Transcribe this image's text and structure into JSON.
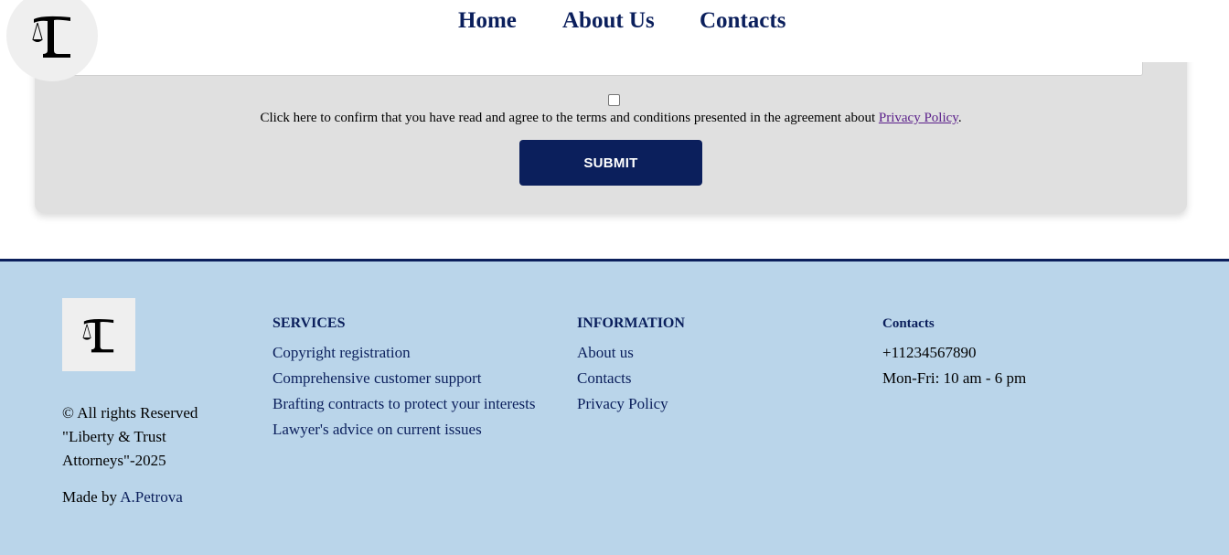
{
  "nav": {
    "home": "Home",
    "about": "About Us",
    "contacts": "Contacts"
  },
  "form": {
    "agree_text": "Click here to confirm that you have read and agree to the terms and conditions presented in the agreement about ",
    "privacy_link": "Privacy Policy",
    "agree_end": ".",
    "submit_label": "SUBMIT"
  },
  "footer": {
    "copyright_line1": "© All rights Reserved",
    "copyright_line2": "\"Liberty & Trust",
    "copyright_line3": "Attorneys\"-2025",
    "made_by_prefix": "Made by ",
    "made_by_author": "A.Petrova",
    "services": {
      "heading": "SERVICES",
      "items": [
        "Copyright registration",
        "Comprehensive customer support",
        "Brafting contracts to protect your interests",
        "Lawyer's advice on current issues"
      ]
    },
    "information": {
      "heading": "INFORMATION",
      "items": [
        "About us",
        "Contacts",
        "Privacy Policy"
      ]
    },
    "contacts": {
      "heading": "Contacts",
      "phone": "+11234567890",
      "hours": "Mon-Fri: 10 am - 6 pm"
    }
  },
  "colors": {
    "brand_navy": "#0b1f5c",
    "footer_bg": "#bad5ea",
    "card_bg": "#e0e0e0",
    "link_visited": "#5a1f8a"
  },
  "icons": {
    "logo": "scales-of-justice-logo-icon"
  }
}
